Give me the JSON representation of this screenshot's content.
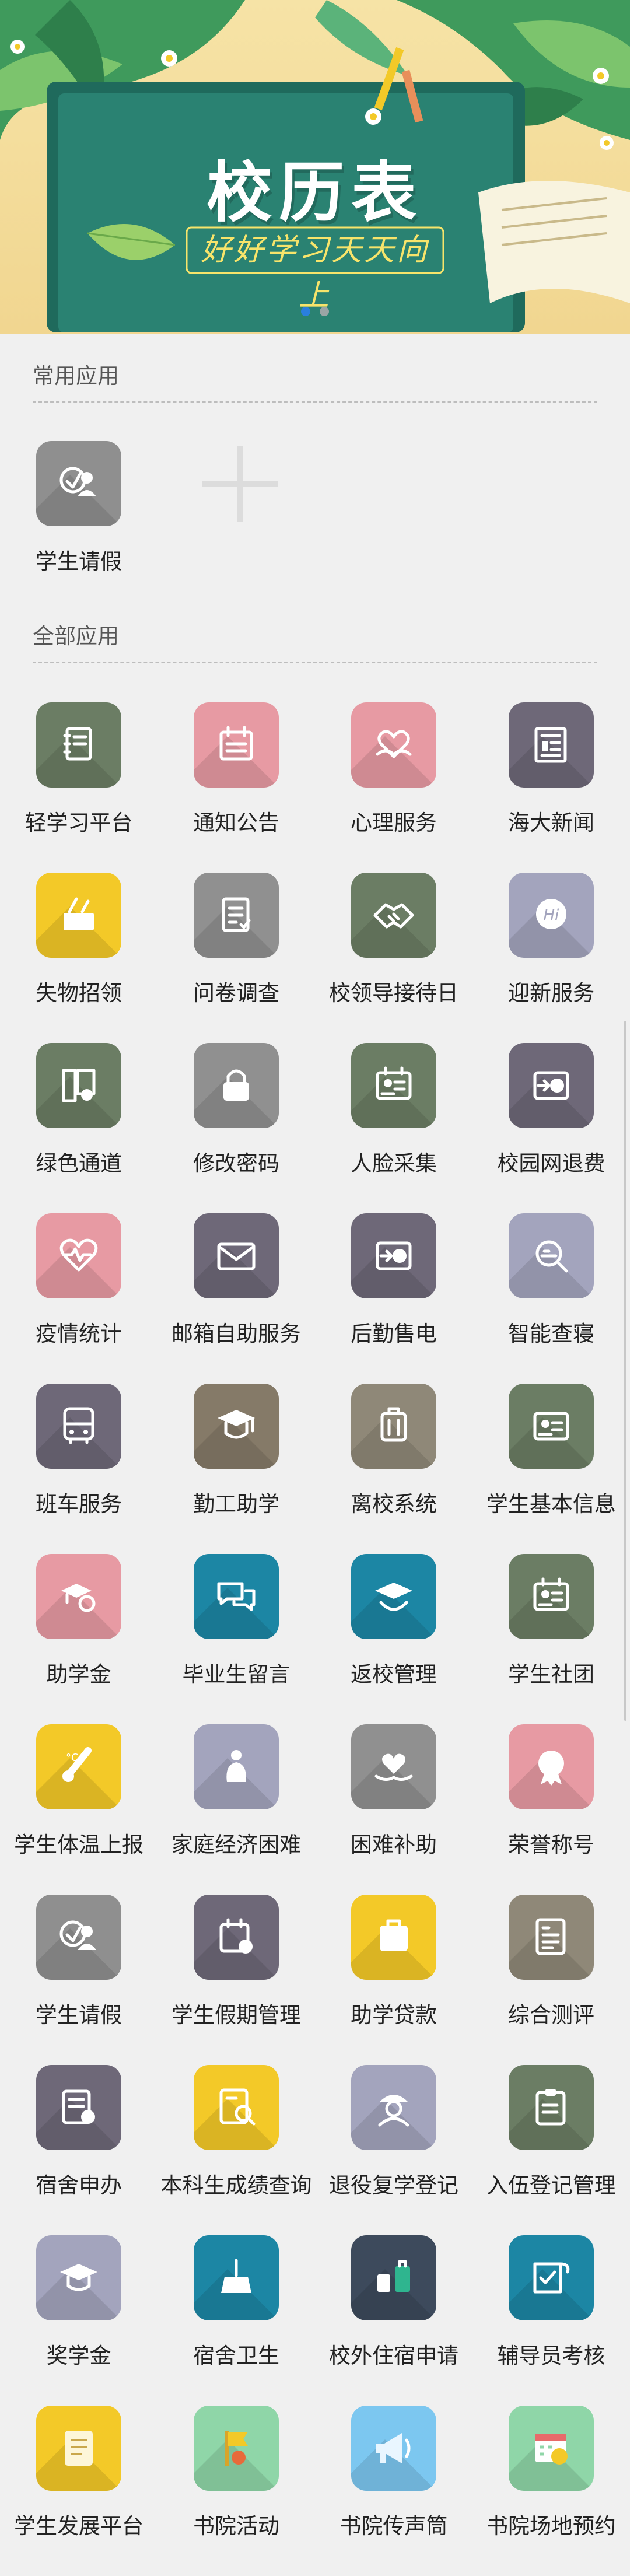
{
  "banner": {
    "title": "校历表",
    "subtitle": "好好学习天天向上",
    "active_slide": 1,
    "slide_count": 2
  },
  "sections": {
    "common": {
      "title": "常用应用"
    },
    "all": {
      "title": "全部应用"
    }
  },
  "common_apps": [
    {
      "label": "学生请假",
      "color": "#8f8f8f",
      "icon": "student-leave-icon"
    }
  ],
  "all_apps": [
    {
      "label": "轻学习平台",
      "color": "#6b7d64",
      "icon": "notebook-icon"
    },
    {
      "label": "通知公告",
      "color": "#e79aa3",
      "icon": "calendar-note-icon"
    },
    {
      "label": "心理服务",
      "color": "#e79aa3",
      "icon": "heart-hands-icon"
    },
    {
      "label": "海大新闻",
      "color": "#6e6878",
      "icon": "newspaper-icon"
    },
    {
      "label": "失物招领",
      "color": "#f3c928",
      "icon": "lost-found-box-icon"
    },
    {
      "label": "问卷调查",
      "color": "#909090",
      "icon": "survey-icon"
    },
    {
      "label": "校领导接待日",
      "color": "#6b7d64",
      "icon": "handshake-icon"
    },
    {
      "label": "迎新服务",
      "color": "#a3a4bd",
      "icon": "hi-chat-icon"
    },
    {
      "label": "绿色通道",
      "color": "#6b7d64",
      "icon": "green-channel-icon"
    },
    {
      "label": "修改密码",
      "color": "#909090",
      "icon": "lock-icon"
    },
    {
      "label": "人脸采集",
      "color": "#6b7d64",
      "icon": "id-card-icon"
    },
    {
      "label": "校园网退费",
      "color": "#6e6878",
      "icon": "refund-icon"
    },
    {
      "label": "疫情统计",
      "color": "#e79aa3",
      "icon": "heartbeat-icon"
    },
    {
      "label": "邮箱自助服务",
      "color": "#6e6878",
      "icon": "mail-icon"
    },
    {
      "label": "后勤售电",
      "color": "#6e6878",
      "icon": "electric-pay-icon"
    },
    {
      "label": "智能查寝",
      "color": "#a3a4bd",
      "icon": "dorm-check-icon"
    },
    {
      "label": "班车服务",
      "color": "#6e6878",
      "icon": "bus-icon"
    },
    {
      "label": "勤工助学",
      "color": "#857a68",
      "icon": "work-study-icon"
    },
    {
      "label": "离校系统",
      "color": "#8f8878",
      "icon": "luggage-icon"
    },
    {
      "label": "学生基本信息",
      "color": "#6b7d64",
      "icon": "student-info-icon"
    },
    {
      "label": "助学金",
      "color": "#e79aa3",
      "icon": "grant-icon"
    },
    {
      "label": "毕业生留言",
      "color": "#1c86a4",
      "icon": "message-bubbles-icon"
    },
    {
      "label": "返校管理",
      "color": "#1c86a4",
      "icon": "return-school-icon"
    },
    {
      "label": "学生社团",
      "color": "#6b7d64",
      "icon": "club-card-icon"
    },
    {
      "label": "学生体温上报",
      "color": "#f3c928",
      "icon": "thermometer-icon"
    },
    {
      "label": "家庭经济困难",
      "color": "#a3a4bd",
      "icon": "hardship-icon"
    },
    {
      "label": "困难补助",
      "color": "#909090",
      "icon": "subsidy-heart-icon"
    },
    {
      "label": "荣誉称号",
      "color": "#e79aa3",
      "icon": "honor-badge-icon"
    },
    {
      "label": "学生请假",
      "color": "#8f8f8f",
      "icon": "student-leave-icon"
    },
    {
      "label": "学生假期管理",
      "color": "#6e6878",
      "icon": "vacation-icon"
    },
    {
      "label": "助学贷款",
      "color": "#f3c928",
      "icon": "loan-bag-icon"
    },
    {
      "label": "综合测评",
      "color": "#8f8878",
      "icon": "evaluation-icon"
    },
    {
      "label": "宿舍申办",
      "color": "#6e6878",
      "icon": "dorm-apply-icon"
    },
    {
      "label": "本科生成绩查询",
      "color": "#f3c928",
      "icon": "grade-search-icon"
    },
    {
      "label": "退役复学登记",
      "color": "#a3a4bd",
      "icon": "veteran-icon"
    },
    {
      "label": "入伍登记管理",
      "color": "#6b7d64",
      "icon": "enlist-clipboard-icon"
    },
    {
      "label": "奖学金",
      "color": "#a3a4bd",
      "icon": "scholarship-icon"
    },
    {
      "label": "宿舍卫生",
      "color": "#1c86a4",
      "icon": "broom-icon"
    },
    {
      "label": "校外住宿申请",
      "color": "#3d4a5c",
      "icon": "offcampus-stay-icon"
    },
    {
      "label": "辅导员考核",
      "color": "#1c86a4",
      "icon": "counselor-review-icon"
    },
    {
      "label": "学生发展平台",
      "color": "#f3c928",
      "icon": "scroll-icon"
    },
    {
      "label": "书院活动",
      "color": "#8fd6a8",
      "icon": "flag-activity-icon"
    },
    {
      "label": "书院传声筒",
      "color": "#7cc7f0",
      "icon": "megaphone-icon"
    },
    {
      "label": "书院场地预约",
      "color": "#8fd6a8",
      "icon": "venue-calendar-icon"
    }
  ]
}
